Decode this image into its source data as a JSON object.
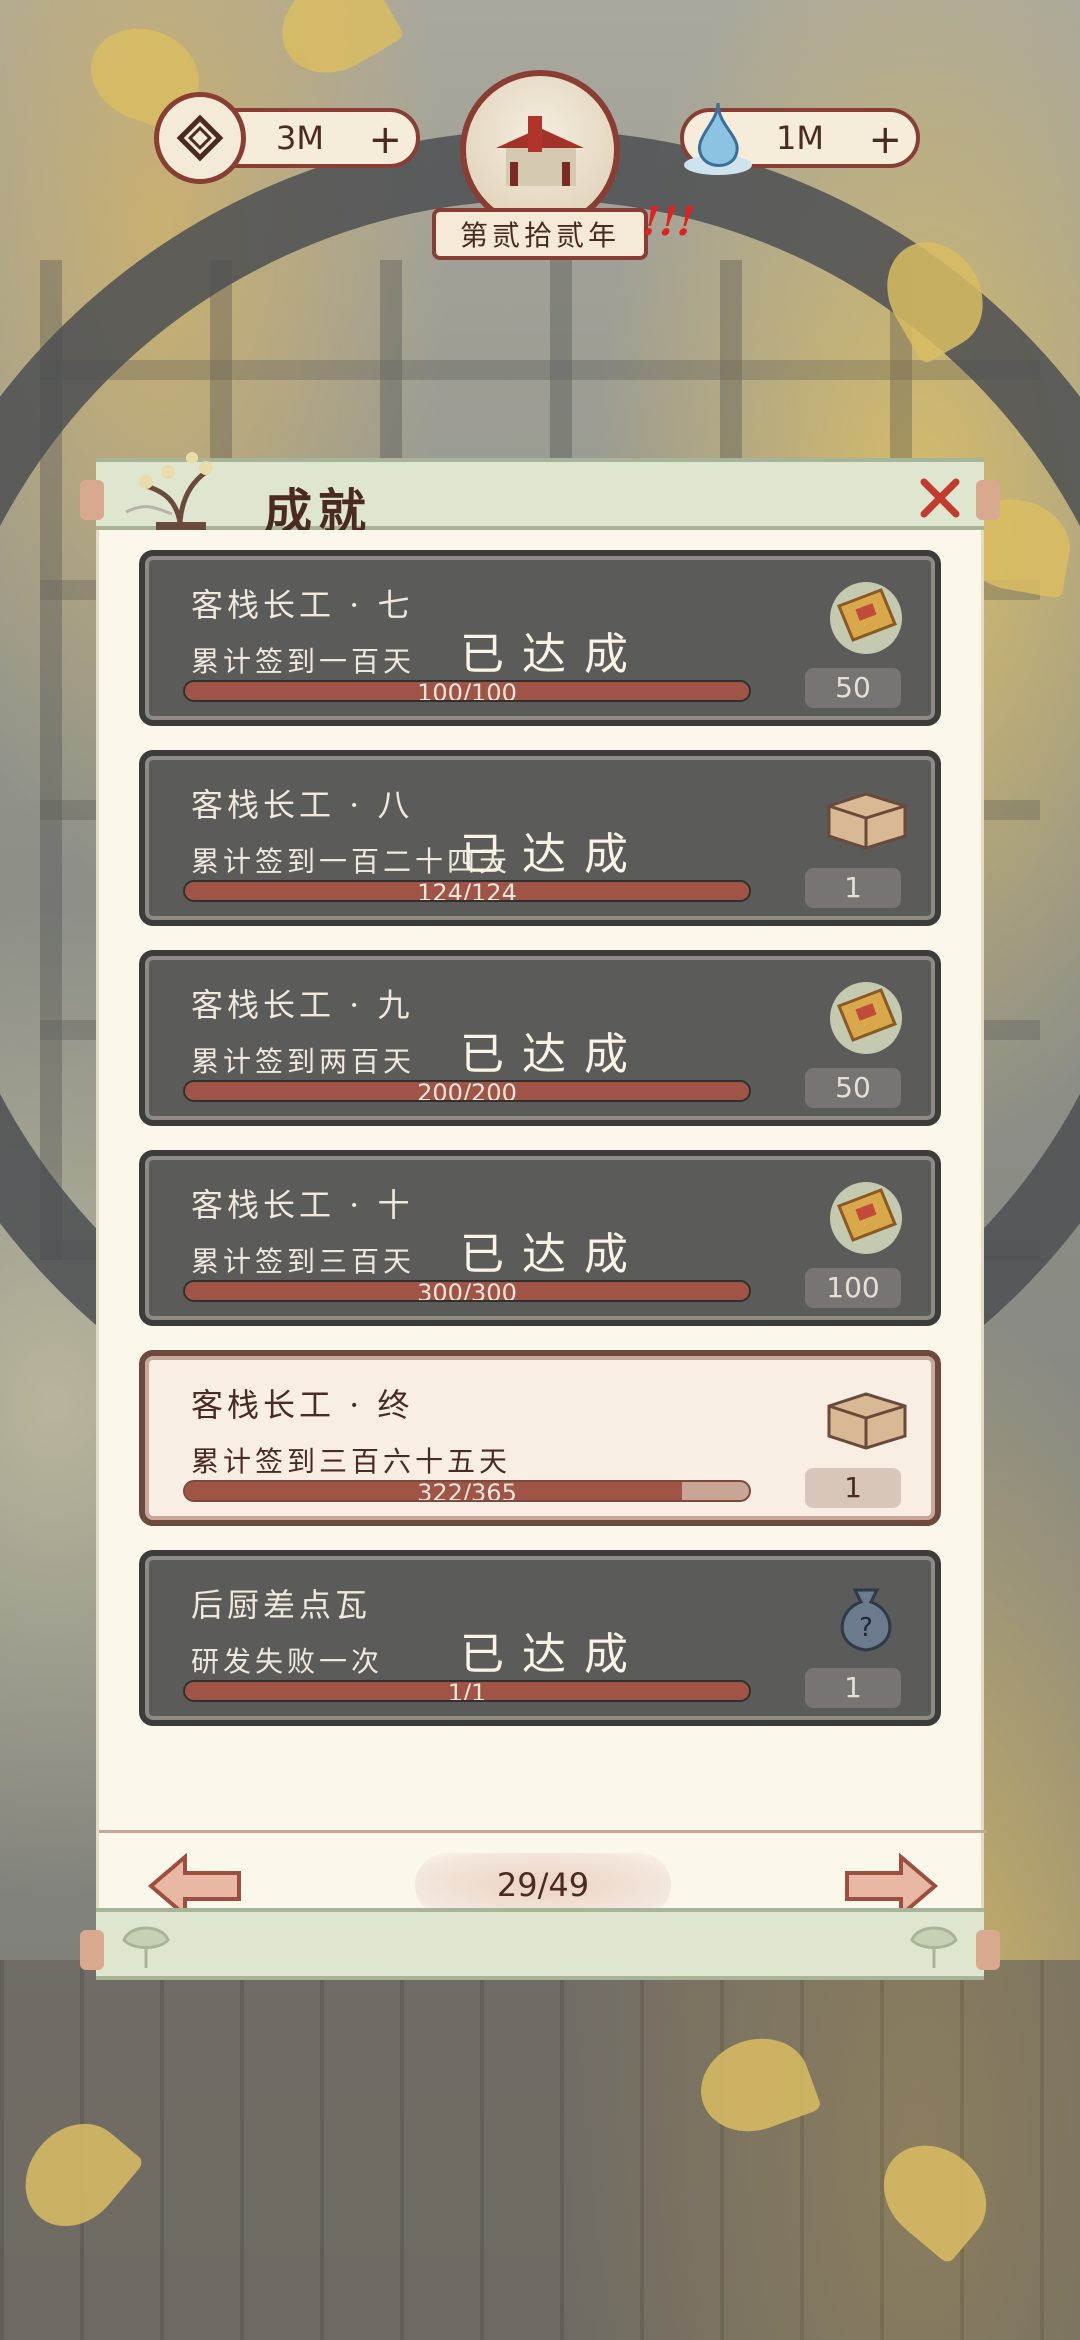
{
  "hud": {
    "coins": "3M",
    "spirit": "1M",
    "year": "第贰拾贰年"
  },
  "panel": {
    "title": "成就",
    "page": "29/49"
  },
  "achievements": [
    {
      "title": "客栈长工 · 七",
      "desc": "累计签到一百天",
      "progress": "100/100",
      "ratio": 1.0,
      "completed": true,
      "done_label": "已达成",
      "reward_icon": "ticket-icon",
      "reward": "50"
    },
    {
      "title": "客栈长工 · 八",
      "desc": "累计签到一百二十四天",
      "progress": "124/124",
      "ratio": 1.0,
      "completed": true,
      "done_label": "已达成",
      "reward_icon": "box-icon",
      "reward": "1"
    },
    {
      "title": "客栈长工 · 九",
      "desc": "累计签到两百天",
      "progress": "200/200",
      "ratio": 1.0,
      "completed": true,
      "done_label": "已达成",
      "reward_icon": "ticket-icon",
      "reward": "50"
    },
    {
      "title": "客栈长工 · 十",
      "desc": "累计签到三百天",
      "progress": "300/300",
      "ratio": 1.0,
      "completed": true,
      "done_label": "已达成",
      "reward_icon": "ticket-icon",
      "reward": "100"
    },
    {
      "title": "客栈长工 · 终",
      "desc": "累计签到三百六十五天",
      "progress": "322/365",
      "ratio": 0.882,
      "completed": false,
      "done_label": "",
      "reward_icon": "box-icon",
      "reward": "1"
    },
    {
      "title": "后厨差点瓦",
      "desc": "研发失败一次",
      "progress": "1/1",
      "ratio": 1.0,
      "completed": true,
      "done_label": "已达成",
      "reward_icon": "pouch-icon",
      "reward": "1"
    }
  ]
}
